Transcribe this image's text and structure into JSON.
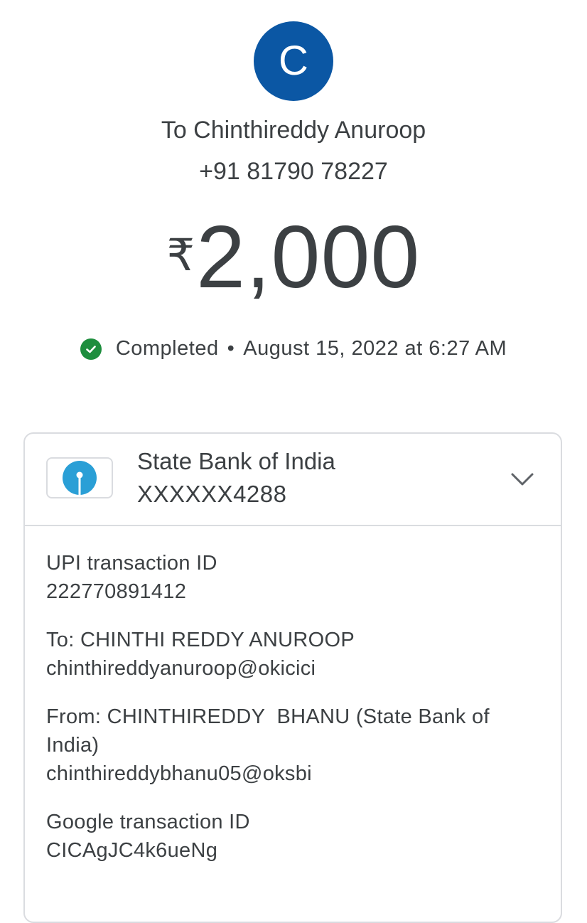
{
  "header": {
    "avatar_letter": "C",
    "avatar_color": "#0b57a4",
    "recipient_name": "To Chinthireddy Anuroop",
    "recipient_phone": "+91 81790 78227"
  },
  "amount": {
    "currency_symbol": "₹",
    "value": "2,000"
  },
  "status": {
    "icon": "check-circle-icon",
    "icon_color": "#1e8e3e",
    "label": "Completed",
    "separator": "•",
    "datetime": "August 15, 2022 at 6:27 AM"
  },
  "bank": {
    "logo_icon": "sbi-logo-icon",
    "logo_color": "#2a9fd6",
    "name": "State Bank of India",
    "account": "XXXXXX4288",
    "expand_icon": "chevron-down-icon"
  },
  "details": {
    "upi_label": "UPI transaction ID",
    "upi_value": "222770891412",
    "to_label": "To: CHINTHI REDDY ANUROOP",
    "to_value": "chinthireddyanuroop@okicici",
    "from_label": "From: CHINTHIREDDY  BHANU (State Bank of India)",
    "from_value": "chinthireddybhanu05@oksbi",
    "google_label": "Google transaction ID",
    "google_value": "CICAgJC4k6ueNg"
  }
}
